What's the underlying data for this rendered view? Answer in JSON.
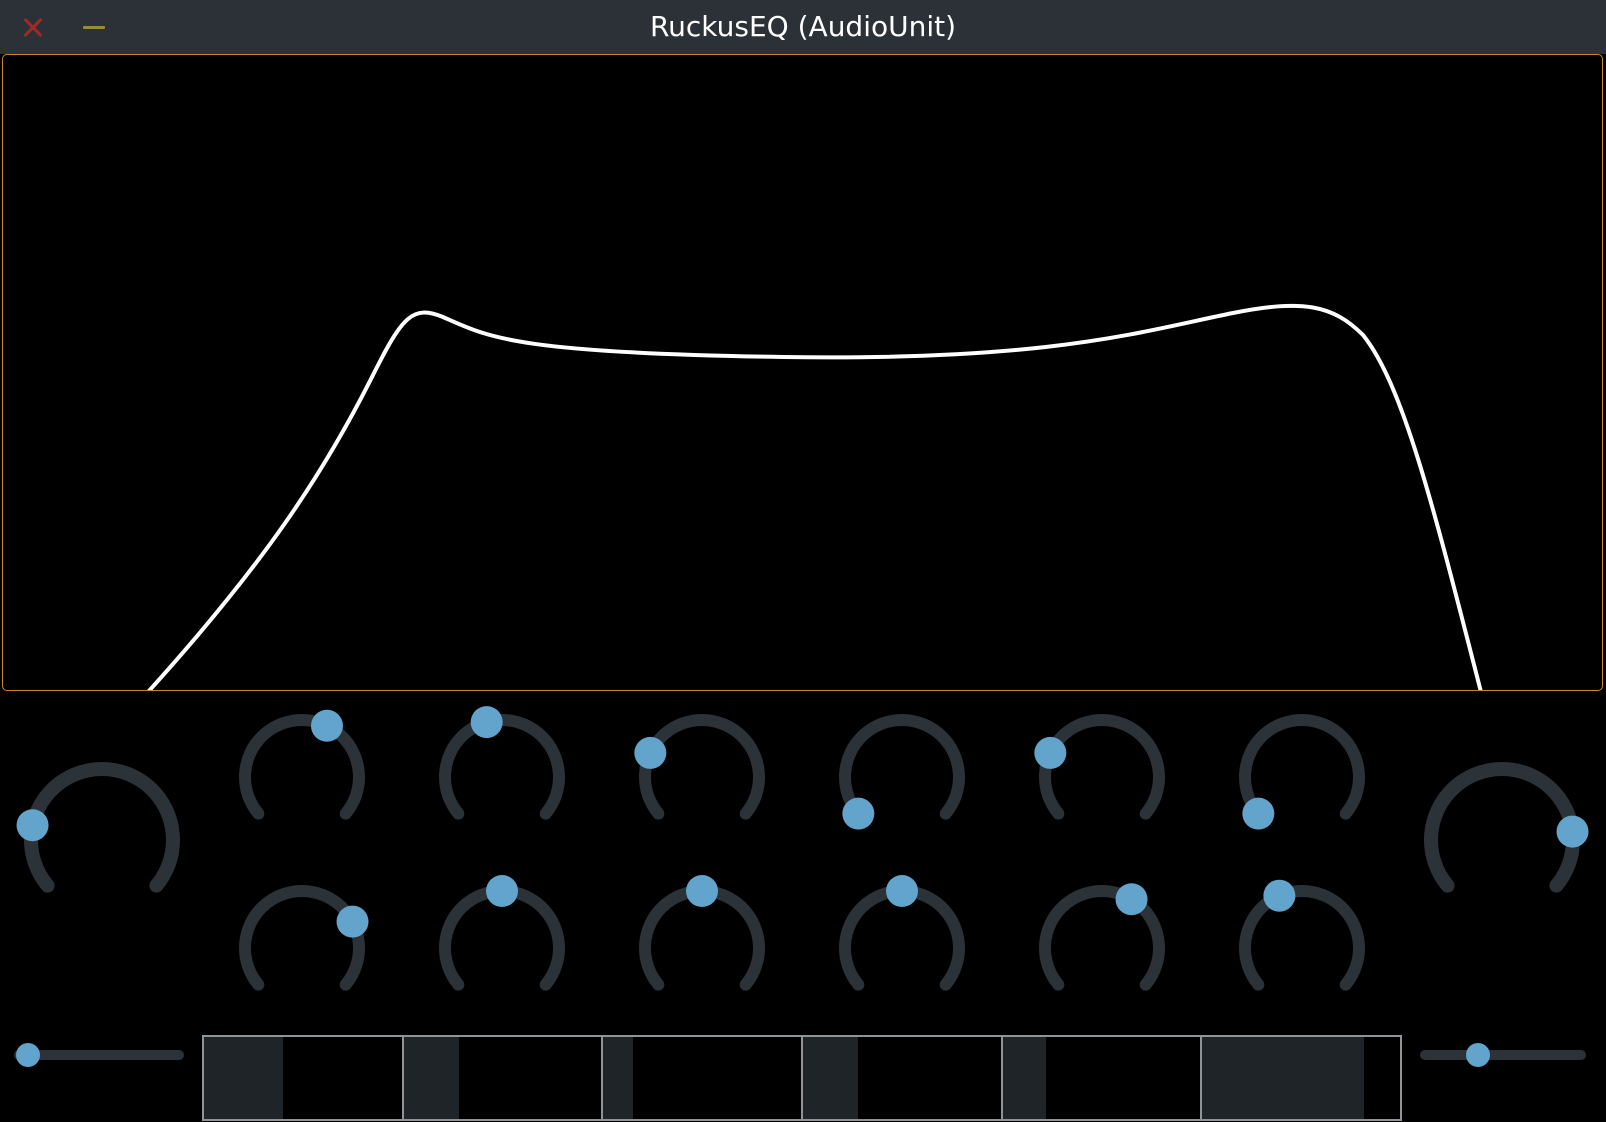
{
  "window": {
    "title": "RuckusEQ (AudioUnit)"
  },
  "colors": {
    "titlebar": "#2b3137",
    "display_border": "#c8882a",
    "curve": "#ffffff",
    "knob_track": "#2c3338",
    "knob_thumb": "#62a4cc",
    "meter_fill": "#1f2428",
    "meter_border": "#8f9499",
    "close": "#a02a28",
    "minimize": "#9a8a3a"
  },
  "icons": {
    "close": "close-icon",
    "minimize": "minimize-icon"
  },
  "knobs": {
    "left_large": 0.2,
    "right_large": 0.82,
    "top_row": [
      0.6,
      0.44,
      0.25,
      0.0,
      0.25,
      0.0
    ],
    "bottom_row": [
      0.74,
      0.5,
      0.5,
      0.5,
      0.62,
      0.41
    ]
  },
  "sliders": {
    "left": 0.08,
    "right": 0.35
  },
  "meters": [
    0.4,
    0.28,
    0.15,
    0.28,
    0.22,
    0.82
  ]
}
